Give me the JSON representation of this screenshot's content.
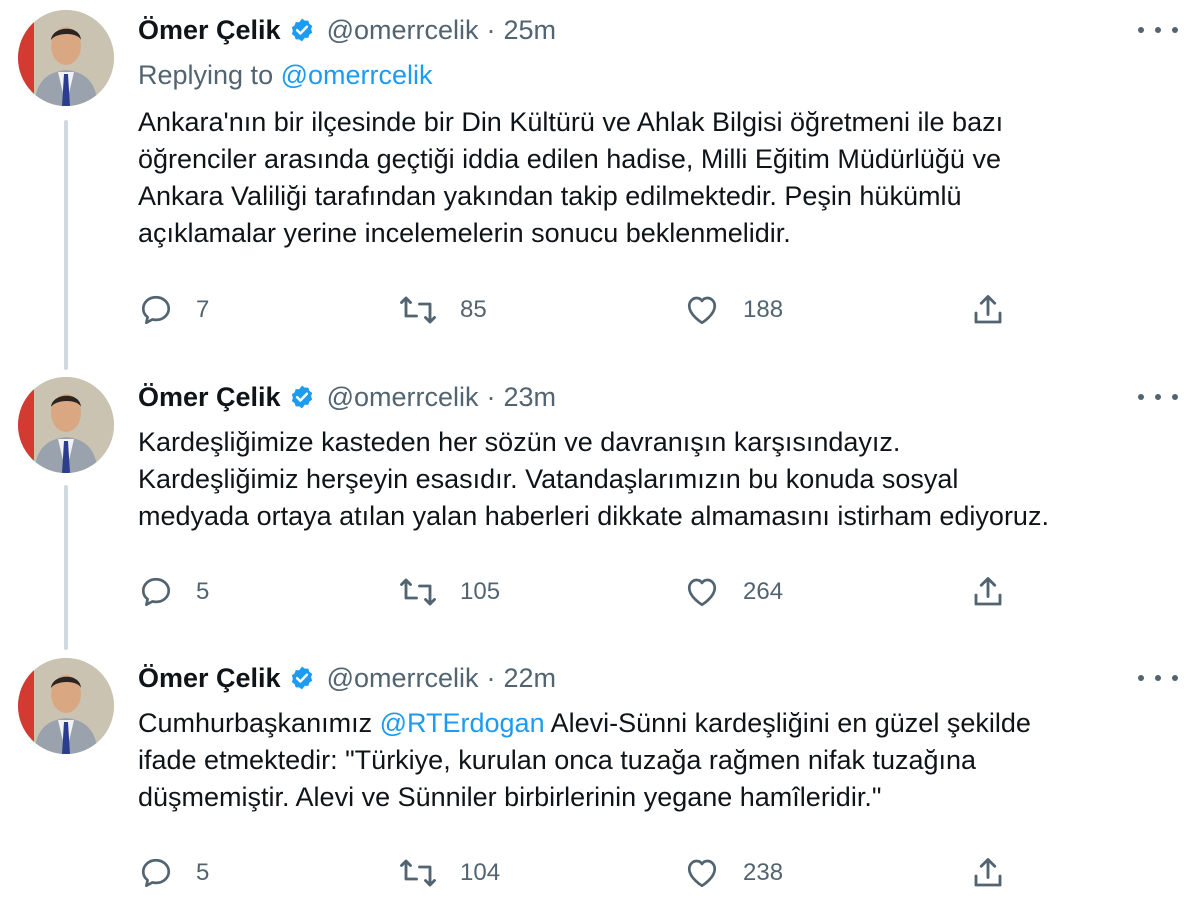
{
  "tweets": [
    {
      "name": "Ömer Çelik",
      "handle": "@omerrcelik",
      "separator": "·",
      "time": "25m",
      "replying_prefix": "Replying to",
      "replying_to": "@omerrcelik",
      "lines": [
        "Ankara'nın bir ilçesinde bir Din Kültürü ve Ahlak Bilgisi öğretmeni ile bazı",
        "öğrenciler arasında geçtiği iddia edilen hadise, Milli Eğitim Müdürlüğü ve",
        "Ankara Valiliği tarafından yakından takip edilmektedir. Peşin hükümlü",
        "açıklamalar yerine incelemelerin sonucu beklenmelidir."
      ],
      "replies": "7",
      "retweets": "85",
      "likes": "188"
    },
    {
      "name": "Ömer Çelik",
      "handle": "@omerrcelik",
      "separator": "·",
      "time": "23m",
      "lines": [
        "Kardeşliğimize kasteden her sözün ve davranışın karşısındayız.",
        "Kardeşliğimiz herşeyin esasıdır. Vatandaşlarımızın bu konuda sosyal",
        "medyada ortaya atılan yalan haberleri dikkate almamasını istirham ediyoruz."
      ],
      "replies": "5",
      "retweets": "105",
      "likes": "264"
    },
    {
      "name": "Ömer Çelik",
      "handle": "@omerrcelik",
      "separator": "·",
      "time": "22m",
      "line1_before": "Cumhurbaşkanımız ",
      "line1_mention": "@RTErdogan",
      "line1_after": " Alevi-Sünni kardeşliğini en güzel şekilde",
      "lines": [
        "ifade etmektedir: \"Türkiye, kurulan onca tuzağa rağmen nifak tuzağına",
        "düşmemiştir. Alevi ve Sünniler birbirlerinin yegane hamîleridir.\""
      ],
      "replies": "5",
      "retweets": "104",
      "likes": "238"
    }
  ],
  "colors": {
    "text": "#0f1419",
    "secondary": "#536471",
    "link": "#1d9bf0",
    "verified": "#1d9bf0",
    "thread_line": "#cfd9de"
  },
  "icons": [
    "verified-badge-icon",
    "more-icon",
    "reply-icon",
    "retweet-icon",
    "like-icon",
    "share-icon"
  ]
}
